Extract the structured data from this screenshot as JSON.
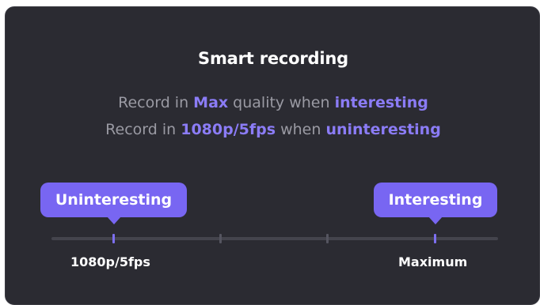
{
  "card": {
    "title": "Smart recording",
    "line1": {
      "prefix": "Record in ",
      "quality": "Max",
      "middle": " quality when ",
      "condition": "interesting"
    },
    "line2": {
      "prefix": "Record in ",
      "quality": "1080p/5fps",
      "middle": " when ",
      "condition": "uninteresting"
    }
  },
  "slider": {
    "left_pill": "Uninteresting",
    "right_pill": "Interesting",
    "left_label": "1080p/5fps",
    "right_label": "Maximum",
    "stop_count": 4,
    "active_stops": [
      1,
      4
    ]
  },
  "colors": {
    "card_background": "#2b2b32",
    "accent": "#7866f2",
    "highlight_text": "#8b7cf6",
    "muted_text": "#9a9aa3"
  }
}
